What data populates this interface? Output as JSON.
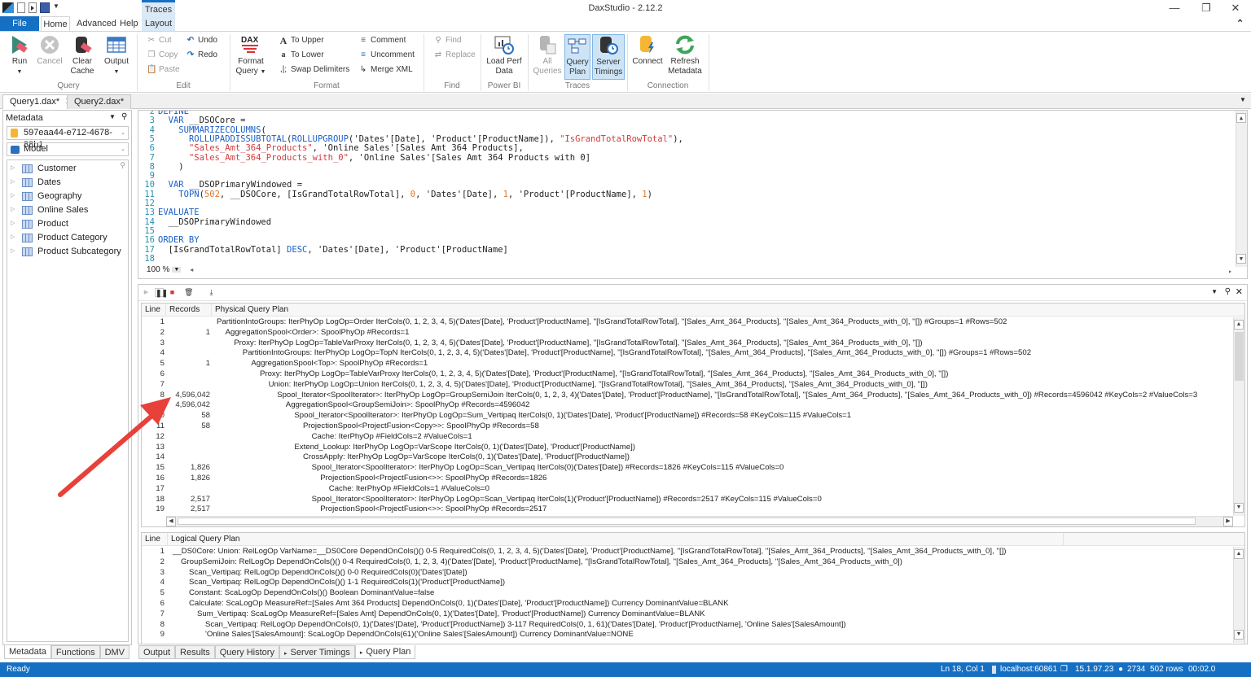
{
  "window": {
    "title": "DaxStudio - 2.12.2"
  },
  "ribbon_tabs": {
    "file": "File",
    "home": "Home",
    "advanced": "Advanced",
    "help": "Help",
    "context_group": "Traces",
    "layout": "Layout"
  },
  "ribbon": {
    "query_group": {
      "label": "Query",
      "run": "Run",
      "cancel": "Cancel",
      "clear_cache": "Clear Cache",
      "output": "Output"
    },
    "edit_group": {
      "label": "Edit",
      "cut": "Cut",
      "copy": "Copy",
      "paste": "Paste",
      "undo": "Undo",
      "redo": "Redo"
    },
    "format_group": {
      "label": "Format",
      "format_query": "Format Query",
      "to_upper": "To Upper",
      "to_lower": "To Lower",
      "swap_delimiters": "Swap Delimiters",
      "comment": "Comment",
      "uncomment": "Uncomment",
      "merge_xml": "Merge XML"
    },
    "find_group": {
      "label": "Find",
      "find": "Find",
      "replace": "Replace"
    },
    "powerbi_group": {
      "label": "Power BI",
      "load_perf_data": "Load Perf Data"
    },
    "traces_group": {
      "label": "Traces",
      "all_queries": "All Queries",
      "query_plan": "Query Plan",
      "server_timings": "Server Timings"
    },
    "connection_group": {
      "label": "Connection",
      "connect": "Connect",
      "refresh_metadata": "Refresh Metadata"
    }
  },
  "doc_tabs": [
    {
      "label": "Query1.dax*",
      "active": true
    },
    {
      "label": "Query2.dax*",
      "active": false
    }
  ],
  "metadata": {
    "header": "Metadata",
    "database": "597eaa44-e712-4678-88b1",
    "model": "Model",
    "tables": [
      "Customer",
      "Dates",
      "Geography",
      "Online Sales",
      "Product",
      "Product Category",
      "Product Subcategory"
    ]
  },
  "left_bottom_tabs": [
    "Metadata",
    "Functions",
    "DMV"
  ],
  "editor": {
    "zoom": "100 %",
    "lines": [
      {
        "n": "2",
        "tokens": [
          [
            "kw",
            "DEFINE"
          ]
        ]
      },
      {
        "n": "3",
        "tokens": [
          [
            "tx",
            "  "
          ],
          [
            "kw",
            "VAR"
          ],
          [
            "tx",
            " __DSOCore ="
          ]
        ]
      },
      {
        "n": "4",
        "tokens": [
          [
            "tx",
            "    "
          ],
          [
            "fn",
            "SUMMARIZECOLUMNS"
          ],
          [
            "tx",
            "("
          ]
        ]
      },
      {
        "n": "5",
        "tokens": [
          [
            "tx",
            "      "
          ],
          [
            "fn",
            "ROLLUPADDISSUBTOTAL"
          ],
          [
            "tx",
            "("
          ],
          [
            "fn",
            "ROLLUPGROUP"
          ],
          [
            "tx",
            "('Dates'[Date], 'Product'[ProductName]), "
          ],
          [
            "str",
            "\"IsGrandTotalRowTotal\""
          ],
          [
            "tx",
            "),"
          ]
        ]
      },
      {
        "n": "6",
        "tokens": [
          [
            "tx",
            "      "
          ],
          [
            "str",
            "\"Sales_Amt_364_Products\""
          ],
          [
            "tx",
            ", 'Online Sales'[Sales Amt 364 Products],"
          ]
        ]
      },
      {
        "n": "7",
        "tokens": [
          [
            "tx",
            "      "
          ],
          [
            "str",
            "\"Sales_Amt_364_Products_with_0\""
          ],
          [
            "tx",
            ", 'Online Sales'[Sales Amt 364 Products with 0]"
          ]
        ]
      },
      {
        "n": "8",
        "tokens": [
          [
            "tx",
            "    )"
          ]
        ]
      },
      {
        "n": "9",
        "tokens": []
      },
      {
        "n": "10",
        "tokens": [
          [
            "tx",
            "  "
          ],
          [
            "kw",
            "VAR"
          ],
          [
            "tx",
            " __DSOPrimaryWindowed ="
          ]
        ]
      },
      {
        "n": "11",
        "tokens": [
          [
            "tx",
            "    "
          ],
          [
            "fn",
            "TOPN"
          ],
          [
            "tx",
            "("
          ],
          [
            "num",
            "502"
          ],
          [
            "tx",
            ", __DSOCore, [IsGrandTotalRowTotal], "
          ],
          [
            "num",
            "0"
          ],
          [
            "tx",
            ", 'Dates'[Date], "
          ],
          [
            "num",
            "1"
          ],
          [
            "tx",
            ", 'Product'[ProductName], "
          ],
          [
            "num",
            "1"
          ],
          [
            "tx",
            ")"
          ]
        ]
      },
      {
        "n": "12",
        "tokens": []
      },
      {
        "n": "13",
        "tokens": [
          [
            "kw",
            "EVALUATE"
          ]
        ]
      },
      {
        "n": "14",
        "tokens": [
          [
            "tx",
            "  __DSOPrimaryWindowed"
          ]
        ]
      },
      {
        "n": "15",
        "tokens": []
      },
      {
        "n": "16",
        "tokens": [
          [
            "kw",
            "ORDER BY"
          ]
        ]
      },
      {
        "n": "17",
        "tokens": [
          [
            "tx",
            "  [IsGrandTotalRowTotal] "
          ],
          [
            "kw",
            "DESC"
          ],
          [
            "tx",
            ", 'Dates'[Date], 'Product'[ProductName]"
          ]
        ]
      },
      {
        "n": "18",
        "tokens": []
      }
    ]
  },
  "physical_plan": {
    "headers": {
      "line": "Line",
      "records": "Records",
      "plan": "Physical Query Plan"
    },
    "rows": [
      {
        "line": "1",
        "records": "",
        "indent": 0,
        "text": "PartitionIntoGroups: IterPhyOp LogOp=Order IterCols(0, 1, 2, 3, 4, 5)('Dates'[Date], 'Product'[ProductName], ''[IsGrandTotalRowTotal], ''[Sales_Amt_364_Products], ''[Sales_Amt_364_Products_with_0], ''[]) #Groups=1 #Rows=502"
      },
      {
        "line": "2",
        "records": "1",
        "indent": 1,
        "text": "AggregationSpool<Order>: SpoolPhyOp #Records=1"
      },
      {
        "line": "3",
        "records": "",
        "indent": 2,
        "text": "Proxy: IterPhyOp LogOp=TableVarProxy IterCols(0, 1, 2, 3, 4, 5)('Dates'[Date], 'Product'[ProductName], ''[IsGrandTotalRowTotal], ''[Sales_Amt_364_Products], ''[Sales_Amt_364_Products_with_0], ''[])"
      },
      {
        "line": "4",
        "records": "",
        "indent": 3,
        "text": "PartitionIntoGroups: IterPhyOp LogOp=TopN IterCols(0, 1, 2, 3, 4, 5)('Dates'[Date], 'Product'[ProductName], ''[IsGrandTotalRowTotal], ''[Sales_Amt_364_Products], ''[Sales_Amt_364_Products_with_0], ''[]) #Groups=1 #Rows=502"
      },
      {
        "line": "5",
        "records": "1",
        "indent": 4,
        "text": "AggregationSpool<Top>: SpoolPhyOp #Records=1"
      },
      {
        "line": "6",
        "records": "",
        "indent": 5,
        "text": "Proxy: IterPhyOp LogOp=TableVarProxy IterCols(0, 1, 2, 3, 4, 5)('Dates'[Date], 'Product'[ProductName], ''[IsGrandTotalRowTotal], ''[Sales_Amt_364_Products], ''[Sales_Amt_364_Products_with_0], ''[])"
      },
      {
        "line": "7",
        "records": "",
        "indent": 6,
        "text": "Union: IterPhyOp LogOp=Union IterCols(0, 1, 2, 3, 4, 5)('Dates'[Date], 'Product'[ProductName], ''[IsGrandTotalRowTotal], ''[Sales_Amt_364_Products], ''[Sales_Amt_364_Products_with_0], ''[])"
      },
      {
        "line": "8",
        "records": "4,596,042",
        "indent": 7,
        "text": "Spool_Iterator<SpoolIterator>: IterPhyOp LogOp=GroupSemiJoin IterCols(0, 1, 2, 3, 4)('Dates'[Date], 'Product'[ProductName], ''[IsGrandTotalRowTotal], ''[Sales_Amt_364_Products], ''[Sales_Amt_364_Products_with_0]) #Records=4596042 #KeyCols=2 #ValueCols=3"
      },
      {
        "line": "9",
        "records": "4,596,042",
        "indent": 8,
        "text": "AggregationSpool<GroupSemiJoin>: SpoolPhyOp #Records=4596042"
      },
      {
        "line": "10",
        "records": "58",
        "indent": 9,
        "text": "Spool_Iterator<SpoolIterator>: IterPhyOp LogOp=Sum_Vertipaq IterCols(0, 1)('Dates'[Date], 'Product'[ProductName]) #Records=58 #KeyCols=115 #ValueCols=1"
      },
      {
        "line": "11",
        "records": "58",
        "indent": 10,
        "text": "ProjectionSpool<ProjectFusion<Copy>>: SpoolPhyOp #Records=58"
      },
      {
        "line": "12",
        "records": "",
        "indent": 11,
        "text": "Cache: IterPhyOp #FieldCols=2 #ValueCols=1"
      },
      {
        "line": "13",
        "records": "",
        "indent": 9,
        "text": "Extend_Lookup: IterPhyOp LogOp=VarScope IterCols(0, 1)('Dates'[Date], 'Product'[ProductName])"
      },
      {
        "line": "14",
        "records": "",
        "indent": 10,
        "text": "CrossApply: IterPhyOp LogOp=VarScope IterCols(0, 1)('Dates'[Date], 'Product'[ProductName])"
      },
      {
        "line": "15",
        "records": "1,826",
        "indent": 11,
        "text": "Spool_Iterator<SpoolIterator>: IterPhyOp LogOp=Scan_Vertipaq IterCols(0)('Dates'[Date]) #Records=1826 #KeyCols=115 #ValueCols=0"
      },
      {
        "line": "16",
        "records": "1,826",
        "indent": 12,
        "text": "ProjectionSpool<ProjectFusion<>>: SpoolPhyOp #Records=1826"
      },
      {
        "line": "17",
        "records": "",
        "indent": 13,
        "text": "Cache: IterPhyOp #FieldCols=1 #ValueCols=0"
      },
      {
        "line": "18",
        "records": "2,517",
        "indent": 11,
        "text": "Spool_Iterator<SpoolIterator>: IterPhyOp LogOp=Scan_Vertipaq IterCols(1)('Product'[ProductName]) #Records=2517 #KeyCols=115 #ValueCols=0"
      },
      {
        "line": "19",
        "records": "2,517",
        "indent": 12,
        "text": "ProjectionSpool<ProjectFusion<>>: SpoolPhyOp #Records=2517"
      }
    ]
  },
  "logical_plan": {
    "headers": {
      "line": "Line",
      "plan": "Logical Query Plan"
    },
    "rows": [
      {
        "line": "1",
        "indent": 0,
        "text": "__DS0Core: Union: RelLogOp VarName=__DS0Core DependOnCols()() 0-5 RequiredCols(0, 1, 2, 3, 4, 5)('Dates'[Date], 'Product'[ProductName], ''[IsGrandTotalRowTotal], ''[Sales_Amt_364_Products], ''[Sales_Amt_364_Products_with_0], ''[])"
      },
      {
        "line": "2",
        "indent": 1,
        "text": "GroupSemiJoin: RelLogOp DependOnCols()() 0-4 RequiredCols(0, 1, 2, 3, 4)('Dates'[Date], 'Product'[ProductName], ''[IsGrandTotalRowTotal], ''[Sales_Amt_364_Products], ''[Sales_Amt_364_Products_with_0])"
      },
      {
        "line": "3",
        "indent": 2,
        "text": "Scan_Vertipaq: RelLogOp DependOnCols()() 0-0 RequiredCols(0)('Dates'[Date])"
      },
      {
        "line": "4",
        "indent": 2,
        "text": "Scan_Vertipaq: RelLogOp DependOnCols()() 1-1 RequiredCols(1)('Product'[ProductName])"
      },
      {
        "line": "5",
        "indent": 2,
        "text": "Constant: ScaLogOp DependOnCols()() Boolean DominantValue=false"
      },
      {
        "line": "6",
        "indent": 2,
        "text": "Calculate: ScaLogOp MeasureRef=[Sales Amt 364 Products] DependOnCols(0, 1)('Dates'[Date], 'Product'[ProductName]) Currency DominantValue=BLANK"
      },
      {
        "line": "7",
        "indent": 3,
        "text": "Sum_Vertipaq: ScaLogOp MeasureRef=[Sales Amt] DependOnCols(0, 1)('Dates'[Date], 'Product'[ProductName]) Currency DominantValue=BLANK"
      },
      {
        "line": "8",
        "indent": 4,
        "text": "Scan_Vertipaq: RelLogOp DependOnCols(0, 1)('Dates'[Date], 'Product'[ProductName]) 3-117 RequiredCols(0, 1, 61)('Dates'[Date], 'Product'[ProductName], 'Online Sales'[SalesAmount])"
      },
      {
        "line": "9",
        "indent": 4,
        "text": "'Online Sales'[SalesAmount]: ScaLogOp DependOnCols(61)('Online Sales'[SalesAmount]) Currency DominantValue=NONE"
      }
    ]
  },
  "bottom_tabs": [
    "Output",
    "Results",
    "Query History",
    "Server Timings",
    "Query Plan"
  ],
  "status": {
    "ready": "Ready",
    "position": "Ln 18, Col 1",
    "server": "localhost:60861",
    "version": "15.1.97.23",
    "spid": "2734",
    "rows": "502 rows",
    "duration": "00:02.0"
  },
  "colors": {
    "accent": "#1570c4",
    "annotation_arrow": "#e8413a"
  }
}
